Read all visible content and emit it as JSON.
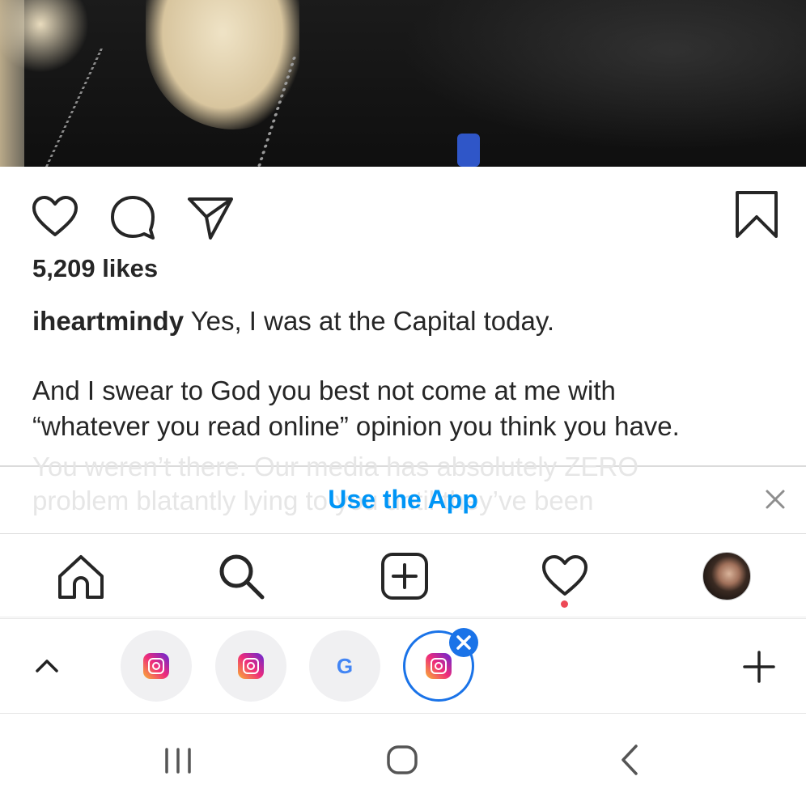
{
  "post": {
    "likes": "5,209 likes",
    "username": "iheartmindy",
    "caption_line1": " Yes, I was at the Capital today.",
    "caption_para2_line1": "And I swear to God you best not come at me with",
    "caption_para2_line2": "“whatever you read online” opinion you think you have.",
    "caption_para2_line3": "You weren’t there. Our media has absolutely ZERO",
    "caption_para2_line4": "problem blatantly lying to you until they’ve been"
  },
  "actions": {
    "icons": [
      "heart-icon",
      "comment-icon",
      "share-icon",
      "bookmark-icon"
    ]
  },
  "banner": {
    "cta": "Use the App",
    "close_icon": "close-icon"
  },
  "ig_nav": {
    "icons": [
      "home-icon",
      "search-icon",
      "new-post-icon",
      "activity-icon",
      "profile-avatar"
    ],
    "activity_dot_color": "#ed4956"
  },
  "browser_tabs": {
    "tabs": [
      {
        "icon": "instagram-icon",
        "active": false
      },
      {
        "icon": "instagram-icon",
        "active": false
      },
      {
        "icon": "google-icon",
        "label": "G",
        "active": false
      },
      {
        "icon": "instagram-icon",
        "active": true
      }
    ],
    "accent": "#1a73e8"
  },
  "system_nav": {
    "icons": [
      "recents-icon",
      "home-button-icon",
      "back-icon"
    ]
  },
  "colors": {
    "link": "#0095f6",
    "text": "#262626"
  }
}
